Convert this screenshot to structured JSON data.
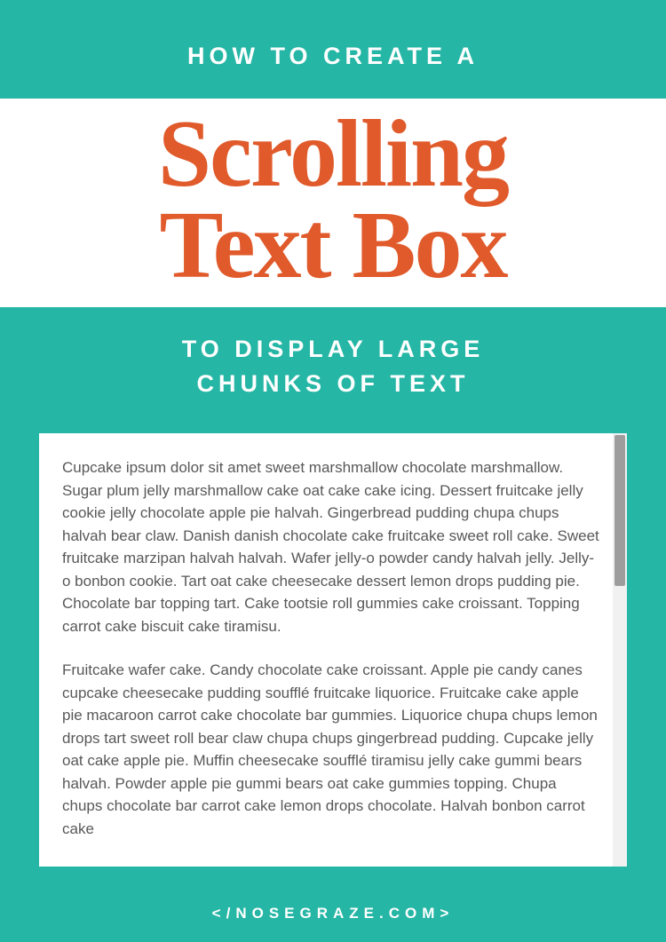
{
  "header": {
    "overline": "HOW TO CREATE A",
    "title_line1": "Scrolling",
    "title_line2": "Text Box",
    "subtitle_line1": "TO DISPLAY LARGE",
    "subtitle_line2": "CHUNKS OF TEXT"
  },
  "scrollbox": {
    "paragraph1": "Cupcake ipsum dolor sit amet sweet marshmallow chocolate marshmal­low. Sugar plum jelly marshmallow cake oat cake cake icing. Dessert fruitcake jelly cookie jelly chocolate apple pie halvah. Gingerbread pud­ding chupa chups halvah bear claw. Danish danish chocolate cake fruit­cake sweet roll cake. Sweet fruitcake marzipan halvah halvah. Wafer jelly-o powder candy halvah jelly. Jelly-o bonbon cookie. Tart oat cake cheesecake dessert lemon drops pudding pie. Chocolate bar topping tart. Cake tootsie roll gummies cake croissant. Topping carrot cake bis­cuit cake tiramisu.",
    "paragraph2": "Fruitcake wafer cake. Candy chocolate cake croissant. Apple pie candy canes cupcake cheesecake pudding soufflé fruitcake liquorice. Fruit­cake cake apple pie macaroon carrot cake chocolate bar gummies. Liquorice chupa chups lemon drops tart sweet roll bear claw chupa chups gingerbread pudding. Cupcake jelly oat cake apple pie. Muffin cheesecake soufflé tiramisu jelly cake gummi bears halvah. Powder apple pie gummi bears oat cake gummies topping. Chupa chups choco­late bar carrot cake lemon drops chocolate. Halvah bonbon carrot cake"
  },
  "footer": {
    "text": "</NOSEGRAZE.COM>"
  },
  "colors": {
    "teal": "#25b6a5",
    "orange": "#e05a2b",
    "white": "#ffffff",
    "body_text": "#585858"
  }
}
